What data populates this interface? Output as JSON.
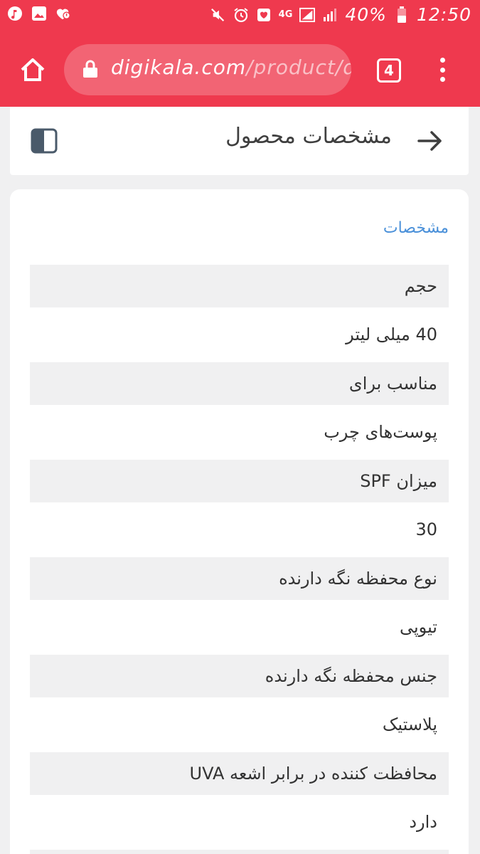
{
  "status_bar": {
    "battery": "40%",
    "network": "4G",
    "time": "12:50"
  },
  "browser": {
    "url_host": "digikala.com",
    "url_path": "/product/d",
    "tab_count": "4"
  },
  "header": {
    "title": "مشخصات محصول"
  },
  "spec": {
    "section_title": "مشخصات",
    "rows": [
      {
        "label": "حجم",
        "value": "40 میلی لیتر"
      },
      {
        "label": "مناسب برای",
        "value": "پوست‌های چرب"
      },
      {
        "label": "میزان SPF",
        "value": "30"
      },
      {
        "label": "نوع محفظه نگه دارنده",
        "value": "تیوپی"
      },
      {
        "label": "جنس محفظه نگه دارنده",
        "value": "پلاستیک"
      },
      {
        "label": "محافظت کننده در برابر اشعه UVA",
        "value": "دارد"
      }
    ]
  },
  "colors": {
    "brand": "#ef394e",
    "link": "#4a90d9",
    "row_label_bg": "#f0f0f1"
  }
}
